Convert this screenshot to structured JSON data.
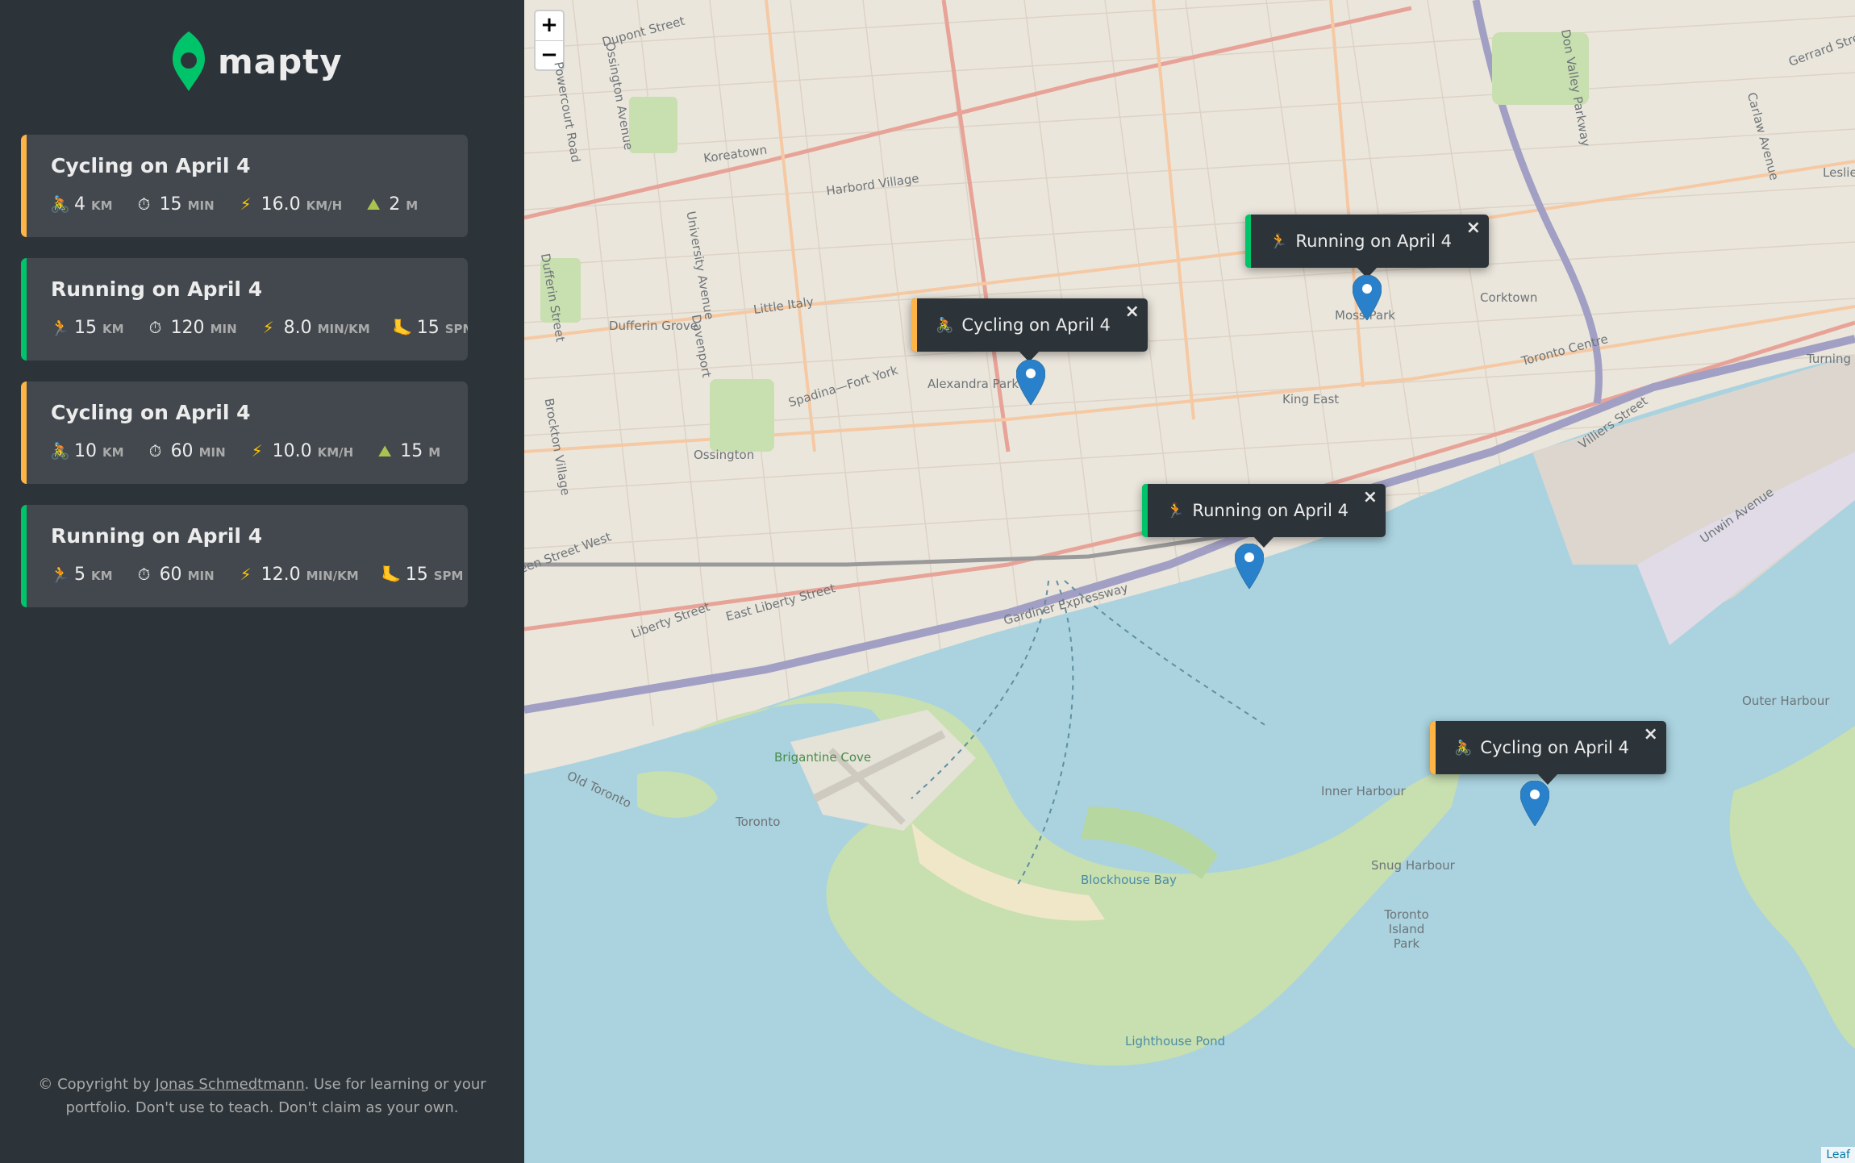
{
  "app": {
    "name": "mapty",
    "logo_color": "#00c46a"
  },
  "colors": {
    "sidebar_bg": "#2d3439",
    "card_bg": "#42484d",
    "cycling_accent": "#ffb545",
    "running_accent": "#00c46a",
    "water": "#aad3df",
    "marker": "#2a81cb"
  },
  "workouts": [
    {
      "type": "cycling",
      "title": "Cycling on April 4",
      "details": [
        {
          "icon": "cyclist-icon",
          "value": "4",
          "unit": "km"
        },
        {
          "icon": "stopwatch-icon",
          "value": "15",
          "unit": "min"
        },
        {
          "icon": "lightning-icon",
          "value": "16.0",
          "unit": "km/h"
        },
        {
          "icon": "mountain-icon",
          "value": "2",
          "unit": "m"
        }
      ]
    },
    {
      "type": "running",
      "title": "Running on April 4",
      "details": [
        {
          "icon": "runner-icon",
          "value": "15",
          "unit": "km"
        },
        {
          "icon": "stopwatch-icon",
          "value": "120",
          "unit": "min"
        },
        {
          "icon": "lightning-icon",
          "value": "8.0",
          "unit": "min/km"
        },
        {
          "icon": "footprint-icon",
          "value": "15",
          "unit": "spm"
        }
      ]
    },
    {
      "type": "cycling",
      "title": "Cycling on April 4",
      "details": [
        {
          "icon": "cyclist-icon",
          "value": "10",
          "unit": "km"
        },
        {
          "icon": "stopwatch-icon",
          "value": "60",
          "unit": "min"
        },
        {
          "icon": "lightning-icon",
          "value": "10.0",
          "unit": "km/h"
        },
        {
          "icon": "mountain-icon",
          "value": "15",
          "unit": "m"
        }
      ]
    },
    {
      "type": "running",
      "title": "Running on April 4",
      "details": [
        {
          "icon": "runner-icon",
          "value": "5",
          "unit": "km"
        },
        {
          "icon": "stopwatch-icon",
          "value": "60",
          "unit": "min"
        },
        {
          "icon": "lightning-icon",
          "value": "12.0",
          "unit": "min/km"
        },
        {
          "icon": "footprint-icon",
          "value": "15",
          "unit": "spm"
        }
      ]
    }
  ],
  "footer": {
    "prefix": "© Copyright by ",
    "author": "Jonas Schmedtmann",
    "suffix": ". Use for learning or your portfolio. Don't use to teach. Don't claim as your own."
  },
  "map": {
    "zoom_in": "+",
    "zoom_out": "−",
    "attribution": "Leaf",
    "popups": [
      {
        "type": "running",
        "icon": "runner-icon",
        "text": "Running on April 4",
        "close": "×"
      },
      {
        "type": "cycling",
        "icon": "cyclist-icon",
        "text": "Cycling on April 4",
        "close": "×"
      },
      {
        "type": "running",
        "icon": "runner-icon",
        "text": "Running on April 4",
        "close": "×"
      },
      {
        "type": "cycling",
        "icon": "cyclist-icon",
        "text": "Cycling on April 4",
        "close": "×"
      }
    ],
    "labels": [
      "Dupont Street",
      "Ossington Avenue",
      "Powercourt Road",
      "Koreatown",
      "Harbord Village",
      "University Avenue",
      "Little Italy",
      "Dufferin Grove",
      "Davenport",
      "Alexandra Park",
      "Spadina—Fort York",
      "Ossington",
      "Brockton Village",
      "Queen Street West",
      "Liberty Street",
      "East Liberty Street",
      "Gardiner Expressway",
      "Brigantine Cove",
      "Old Toronto",
      "Toronto",
      "Blockhouse Bay",
      "Lighthouse Pond",
      "Inner Harbour",
      "Snug Harbour",
      "Toronto Island Park",
      "Corktown",
      "Toronto Centre",
      "King East",
      "Villiers Street",
      "Unwin Avenue",
      "Outer Harbour",
      "Don Valley Parkway",
      "Gerrard Street",
      "Moss Park",
      "Dufferin Street",
      "Carlaw Avenue",
      "Turning Basin",
      "Leslie"
    ]
  }
}
